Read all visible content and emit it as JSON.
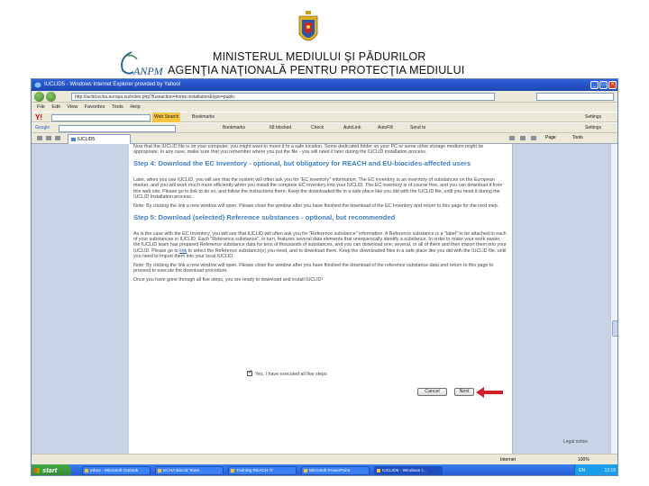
{
  "header": {
    "ministry": "MINISTERUL MEDIULUI ŞI PĂDURILOR",
    "agency": "AGENŢIA NAŢIONALĂ PENTRU PROTECŢIA MEDIULUI",
    "logo_text": "ANPM"
  },
  "browser": {
    "title": "IUCLID5 - Windows Internet Explorer provided by Yahoo!",
    "address": "http://iuclid.echa.europa.eu/index.php?fuseaction=home.installation&type=public",
    "menu": [
      "File",
      "Edit",
      "View",
      "Favorites",
      "Tools",
      "Help"
    ],
    "toolbar1": {
      "search_label": "Web Search",
      "bookmarks": "Bookmarks",
      "settings": "Settings"
    },
    "toolbar2": {
      "google": "Google",
      "bookmarks": "Bookmarks",
      "blocked": "68 blocked",
      "check": "Check",
      "autolink": "AutoLink",
      "autofill": "AutoFill",
      "sendto": "Send to",
      "settings": "Settings"
    },
    "tab_label": "IUCLID5",
    "tools": {
      "page": "Page",
      "tools": "Tools"
    }
  },
  "content": {
    "intro": "Now that the IUCLID file is on your computer, you might want to move it to a safe location. Some dedicated folder on your PC or some other storage medium might be appropriate. In any case, make sure that you remember where you put the file - you will need it later during the IUCLID installation process.",
    "step4_heading": "Step 4: Download the EC Inventory - optional, but obligatory for REACH and EU-biocides-affected users",
    "step4_p1": "Later, when you use IUCLID, you will see that the system will often ask you for \"EC inventory\" information. The EC inventory is an inventory of substances on the European market, and you will work much more efficiently when you install the complete EC inventory into your IUCLID. The EC inventory is of course free, and you can download it from this web site. Please go to link to do so, and follow the instructions there. Keep the downloaded file in a safe place like you did with the IUCLID file, until you need it during the IUCLID installation process.",
    "step4_p2": "Note: By clicking the link a new window will open. Please close the window after you have finished the download of the EC Inventory and return to this page for the next step.",
    "step5_heading": "Step 5: Download (selected) Reference substances - optional, but recommended",
    "step5_p1_before": "As is the case with the EC Inventory, you will see that IUCLID will often ask you for \"Reference substance\" information. A Reference substance is a \"label\" to be attached to each of your substances in IUCLID. Each \"Reference substance\", in turn, features several data elements that unequivocally identify a substance. In order to make your work easier, the IUCLID team has prepared Reference substance data for tens of thousands of substances, and you can download one, several, or all of them and then import them into your IUCLID. Please go to",
    "step5_link": "link",
    "step5_p1_after": "to select the Reference substance(s) you need, and to download them. Keep the downloaded files in a safe place like you did with the IUCLID file, until you need to import them into your local IUCLID.",
    "step5_p2": "Note: By clicking the link a new window will open. Please close the window after you have finished the download of the reference substance data and return to this page to proceed to execute the download procedure.",
    "final": "Once you have gone through all five steps, you are ready to download and install IUCLID!",
    "checkbox_label": "Yes, I have executed all five steps",
    "cancel_label": "Cancel",
    "next_label": "Next",
    "legal": "Legal notice"
  },
  "status": {
    "zone": "Internet",
    "zoom": "100%"
  },
  "taskbar": {
    "start": "start",
    "tasks": [
      "Inbox - Microsoft Outlook",
      "ECHA Biocid Team",
      "Training REACH IT",
      "Microsoft PowerPoint",
      "IUCLID5 - Windows I..."
    ],
    "lang": "EN",
    "clock": "12:16"
  },
  "colors": {
    "heading": "#3e7fc2",
    "titlebar": "#2e63d8",
    "arrow": "#d0202a"
  }
}
